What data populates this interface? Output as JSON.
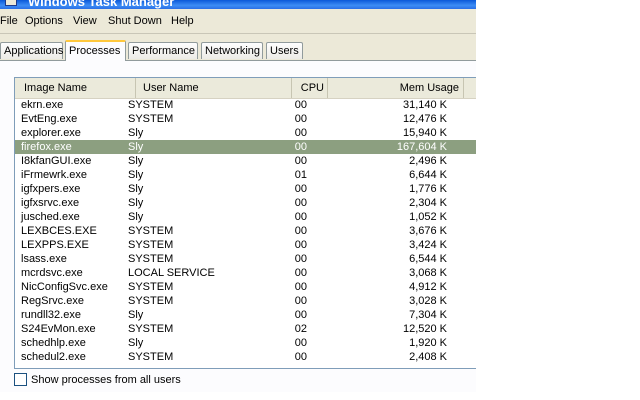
{
  "window": {
    "title": "Windows Task Manager"
  },
  "menu": {
    "items": [
      "File",
      "Options",
      "View",
      "Shut Down",
      "Help"
    ]
  },
  "tabs": [
    "Applications",
    "Processes",
    "Performance",
    "Networking",
    "Users"
  ],
  "active_tab": "Processes",
  "table": {
    "columns": [
      "Image Name",
      "User Name",
      "CPU",
      "Mem Usage"
    ],
    "selected_row": "firefox.exe",
    "rows": [
      {
        "image": "ekrn.exe",
        "user": "SYSTEM",
        "cpu": "00",
        "mem": "31,140 K"
      },
      {
        "image": "EvtEng.exe",
        "user": "SYSTEM",
        "cpu": "00",
        "mem": "12,476 K"
      },
      {
        "image": "explorer.exe",
        "user": "Sly",
        "cpu": "00",
        "mem": "15,940 K"
      },
      {
        "image": "firefox.exe",
        "user": "Sly",
        "cpu": "00",
        "mem": "167,604 K"
      },
      {
        "image": "I8kfanGUI.exe",
        "user": "Sly",
        "cpu": "00",
        "mem": "2,496 K"
      },
      {
        "image": "iFrmewrk.exe",
        "user": "Sly",
        "cpu": "01",
        "mem": "6,644 K"
      },
      {
        "image": "igfxpers.exe",
        "user": "Sly",
        "cpu": "00",
        "mem": "1,776 K"
      },
      {
        "image": "igfxsrvc.exe",
        "user": "Sly",
        "cpu": "00",
        "mem": "2,304 K"
      },
      {
        "image": "jusched.exe",
        "user": "Sly",
        "cpu": "00",
        "mem": "1,052 K"
      },
      {
        "image": "LEXBCES.EXE",
        "user": "SYSTEM",
        "cpu": "00",
        "mem": "3,676 K"
      },
      {
        "image": "LEXPPS.EXE",
        "user": "SYSTEM",
        "cpu": "00",
        "mem": "3,424 K"
      },
      {
        "image": "lsass.exe",
        "user": "SYSTEM",
        "cpu": "00",
        "mem": "6,544 K"
      },
      {
        "image": "mcrdsvc.exe",
        "user": "LOCAL SERVICE",
        "cpu": "00",
        "mem": "3,068 K"
      },
      {
        "image": "NicConfigSvc.exe",
        "user": "SYSTEM",
        "cpu": "00",
        "mem": "4,912 K"
      },
      {
        "image": "RegSrvc.exe",
        "user": "SYSTEM",
        "cpu": "00",
        "mem": "3,028 K"
      },
      {
        "image": "rundll32.exe",
        "user": "Sly",
        "cpu": "00",
        "mem": "7,304 K"
      },
      {
        "image": "S24EvMon.exe",
        "user": "SYSTEM",
        "cpu": "02",
        "mem": "12,520 K"
      },
      {
        "image": "schedhlp.exe",
        "user": "Sly",
        "cpu": "00",
        "mem": "1,920 K"
      },
      {
        "image": "schedul2.exe",
        "user": "SYSTEM",
        "cpu": "00",
        "mem": "2,408 K"
      }
    ]
  },
  "footer": {
    "show_all_label": "Show processes from all users",
    "show_all_checked": false
  }
}
